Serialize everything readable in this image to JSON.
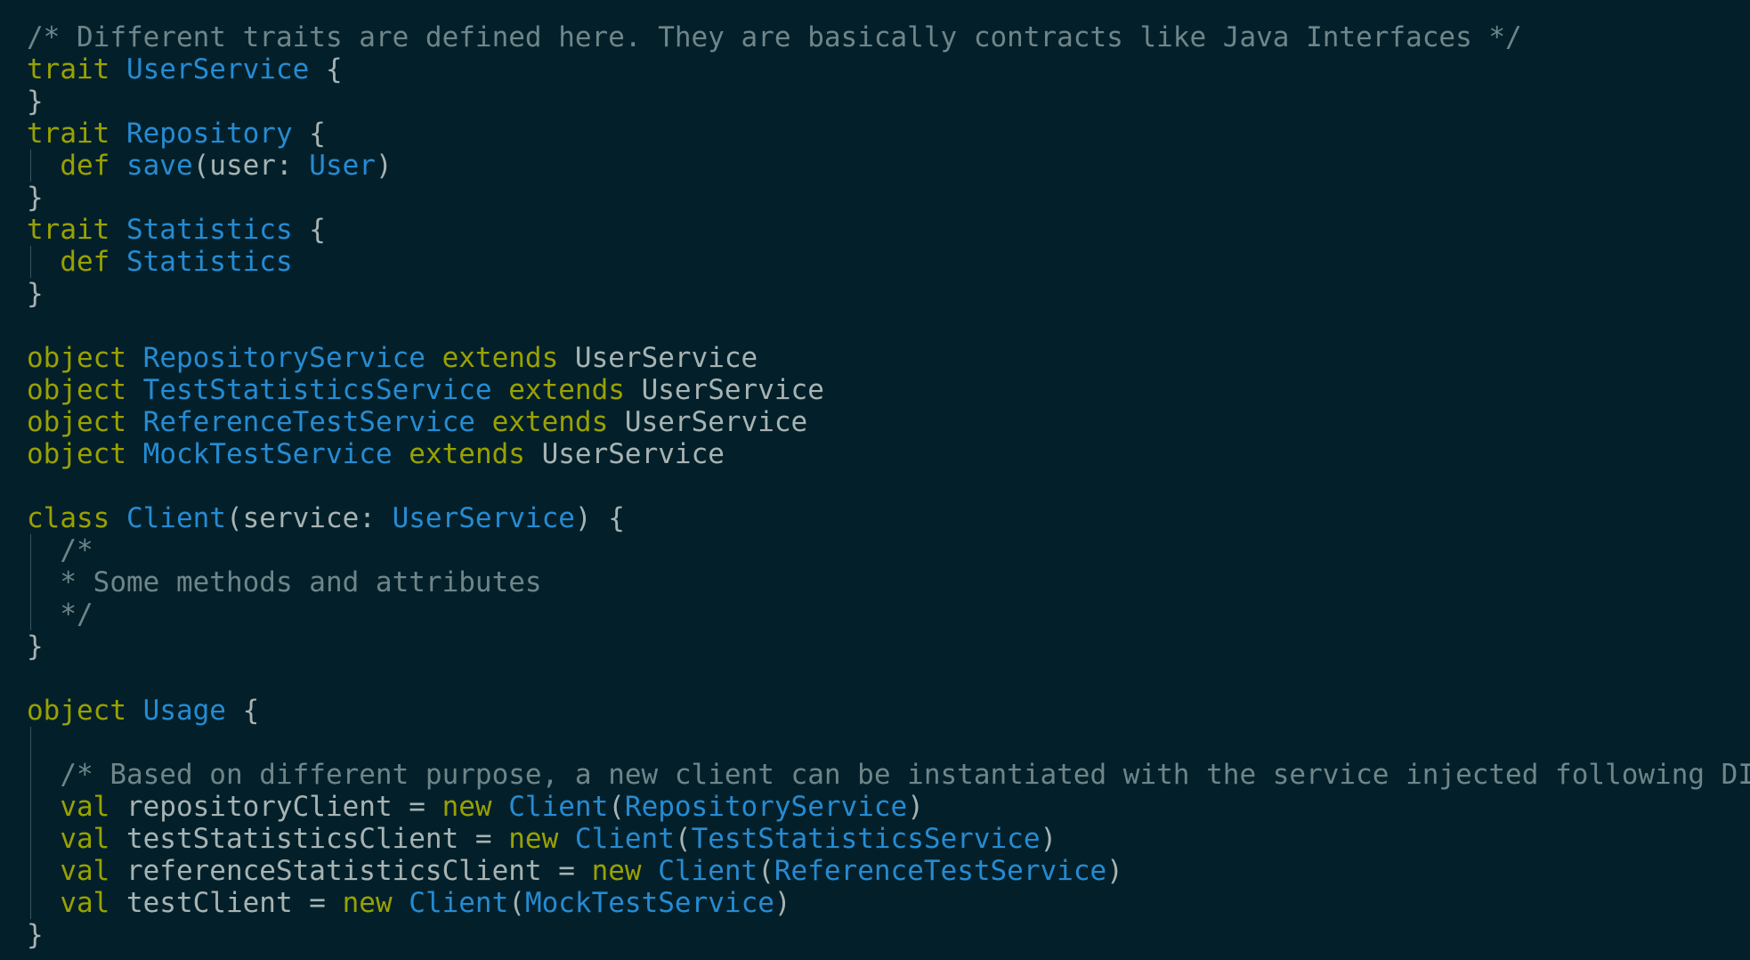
{
  "lines": [
    [
      {
        "t": "/* Different traits are defined here. They are basically contracts like Java Interfaces */",
        "c": "cm"
      }
    ],
    [
      {
        "t": "trait ",
        "c": "kw"
      },
      {
        "t": "UserService",
        "c": "ty"
      },
      {
        "t": " {",
        "c": "pl"
      }
    ],
    [
      {
        "t": "}",
        "c": "pl"
      }
    ],
    [
      {
        "t": "trait ",
        "c": "kw"
      },
      {
        "t": "Repository",
        "c": "ty"
      },
      {
        "t": " {",
        "c": "pl"
      }
    ],
    [
      {
        "t": "  ",
        "c": "pl",
        "g": true
      },
      {
        "t": "def ",
        "c": "kw"
      },
      {
        "t": "save",
        "c": "ty"
      },
      {
        "t": "(user: ",
        "c": "pl"
      },
      {
        "t": "User",
        "c": "ty"
      },
      {
        "t": ")",
        "c": "pl"
      }
    ],
    [
      {
        "t": "}",
        "c": "pl"
      }
    ],
    [
      {
        "t": "trait ",
        "c": "kw"
      },
      {
        "t": "Statistics",
        "c": "ty"
      },
      {
        "t": " {",
        "c": "pl"
      }
    ],
    [
      {
        "t": "  ",
        "c": "pl",
        "g": true
      },
      {
        "t": "def ",
        "c": "kw"
      },
      {
        "t": "Statistics",
        "c": "ty"
      }
    ],
    [
      {
        "t": "}",
        "c": "pl"
      }
    ],
    [],
    [
      {
        "t": "object ",
        "c": "kw"
      },
      {
        "t": "RepositoryService",
        "c": "ty"
      },
      {
        "t": " extends ",
        "c": "kw"
      },
      {
        "t": "UserService",
        "c": "pl"
      }
    ],
    [
      {
        "t": "object ",
        "c": "kw"
      },
      {
        "t": "TestStatisticsService",
        "c": "ty"
      },
      {
        "t": " extends ",
        "c": "kw"
      },
      {
        "t": "UserService",
        "c": "pl"
      }
    ],
    [
      {
        "t": "object ",
        "c": "kw"
      },
      {
        "t": "ReferenceTestService",
        "c": "ty"
      },
      {
        "t": " extends ",
        "c": "kw"
      },
      {
        "t": "UserService",
        "c": "pl"
      }
    ],
    [
      {
        "t": "object ",
        "c": "kw"
      },
      {
        "t": "MockTestService",
        "c": "ty"
      },
      {
        "t": " extends ",
        "c": "kw"
      },
      {
        "t": "UserService",
        "c": "pl"
      }
    ],
    [],
    [
      {
        "t": "class ",
        "c": "kw"
      },
      {
        "t": "Client",
        "c": "ty"
      },
      {
        "t": "(service: ",
        "c": "pl"
      },
      {
        "t": "UserService",
        "c": "ty"
      },
      {
        "t": ") {",
        "c": "pl"
      }
    ],
    [
      {
        "t": "  ",
        "c": "pl",
        "g": true
      },
      {
        "t": "/*",
        "c": "cm"
      }
    ],
    [
      {
        "t": "  ",
        "c": "pl",
        "g": true
      },
      {
        "t": "* Some methods and attributes",
        "c": "cm"
      }
    ],
    [
      {
        "t": "  ",
        "c": "pl",
        "g": true
      },
      {
        "t": "*/",
        "c": "cm"
      }
    ],
    [
      {
        "t": "}",
        "c": "pl"
      }
    ],
    [],
    [
      {
        "t": "object ",
        "c": "kw"
      },
      {
        "t": "Usage",
        "c": "ty"
      },
      {
        "t": " {",
        "c": "pl"
      }
    ],
    [
      {
        "t": "  ",
        "c": "pl",
        "g": true
      }
    ],
    [
      {
        "t": "  ",
        "c": "pl",
        "g": true
      },
      {
        "t": "/* Based on different purpose, a new client can be instantiated with the service injected following DI */",
        "c": "cm"
      }
    ],
    [
      {
        "t": "  ",
        "c": "pl",
        "g": true
      },
      {
        "t": "val ",
        "c": "kw"
      },
      {
        "t": "repositoryClient = ",
        "c": "pl"
      },
      {
        "t": "new ",
        "c": "kw"
      },
      {
        "t": "Client",
        "c": "ty"
      },
      {
        "t": "(",
        "c": "pl"
      },
      {
        "t": "RepositoryService",
        "c": "ty"
      },
      {
        "t": ")",
        "c": "pl"
      }
    ],
    [
      {
        "t": "  ",
        "c": "pl",
        "g": true
      },
      {
        "t": "val ",
        "c": "kw"
      },
      {
        "t": "testStatisticsClient = ",
        "c": "pl"
      },
      {
        "t": "new ",
        "c": "kw"
      },
      {
        "t": "Client",
        "c": "ty"
      },
      {
        "t": "(",
        "c": "pl"
      },
      {
        "t": "TestStatisticsService",
        "c": "ty"
      },
      {
        "t": ")",
        "c": "pl"
      }
    ],
    [
      {
        "t": "  ",
        "c": "pl",
        "g": true
      },
      {
        "t": "val ",
        "c": "kw"
      },
      {
        "t": "referenceStatisticsClient = ",
        "c": "pl"
      },
      {
        "t": "new ",
        "c": "kw"
      },
      {
        "t": "Client",
        "c": "ty"
      },
      {
        "t": "(",
        "c": "pl"
      },
      {
        "t": "ReferenceTestService",
        "c": "ty"
      },
      {
        "t": ")",
        "c": "pl"
      }
    ],
    [
      {
        "t": "  ",
        "c": "pl",
        "g": true
      },
      {
        "t": "val ",
        "c": "kw"
      },
      {
        "t": "testClient = ",
        "c": "pl"
      },
      {
        "t": "new ",
        "c": "kw"
      },
      {
        "t": "Client",
        "c": "ty"
      },
      {
        "t": "(",
        "c": "pl"
      },
      {
        "t": "MockTestService",
        "c": "ty"
      },
      {
        "t": ")",
        "c": "pl"
      }
    ],
    [
      {
        "t": "}",
        "c": "pl"
      }
    ]
  ],
  "theme": {
    "background": "#03202a",
    "keyword": "#9aa100",
    "type": "#268bd2",
    "comment": "#6f8589",
    "plain": "#a7b3b3"
  }
}
